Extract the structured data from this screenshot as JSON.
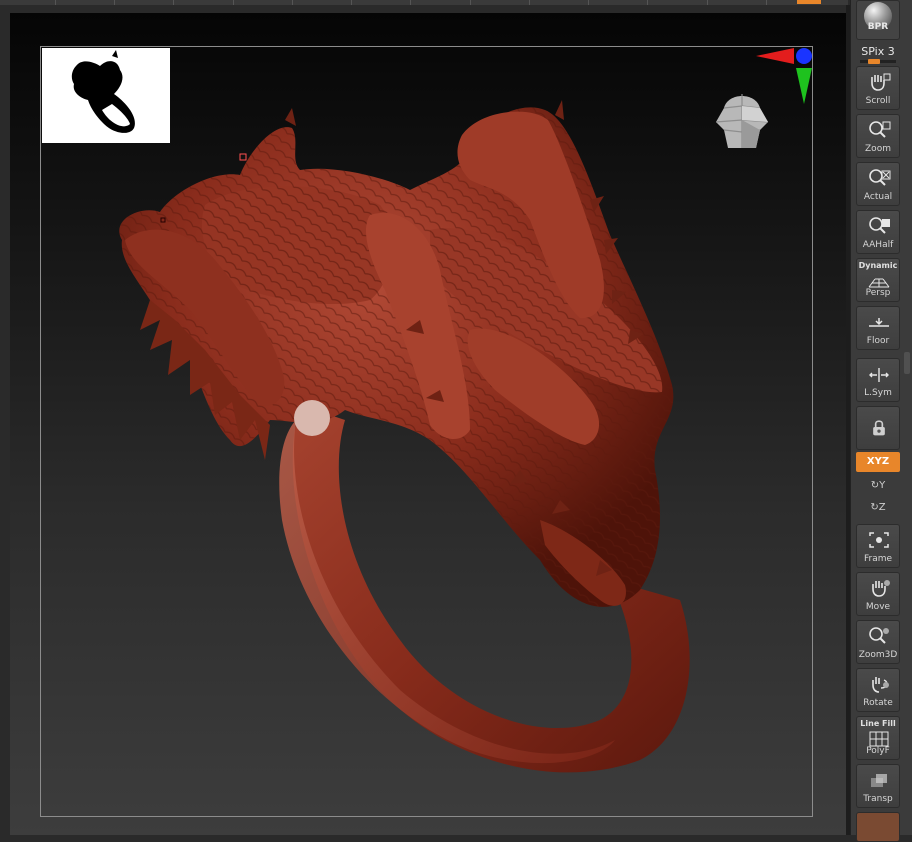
{
  "window": {
    "title": ""
  },
  "shelf": {
    "bpr": {
      "label": "BPR",
      "icon": "sphere-render-icon"
    },
    "spix": {
      "label": "SPix 3",
      "level": 3
    },
    "buttons": [
      {
        "id": "scroll",
        "label": "Scroll",
        "icon": "hand-scroll-icon"
      },
      {
        "id": "zoom",
        "label": "Zoom",
        "icon": "magnify-zoom-icon"
      },
      {
        "id": "actual",
        "label": "Actual",
        "icon": "magnify-actual-icon"
      },
      {
        "id": "aahalf",
        "label": "AAHalf",
        "icon": "magnify-aahalf-icon"
      },
      {
        "id": "persp",
        "label": "Persp",
        "sublabel": "Dynamic",
        "icon": "perspective-grid-icon"
      },
      {
        "id": "floor",
        "label": "Floor",
        "icon": "floor-grid-icon"
      },
      {
        "id": "lsym",
        "label": "L.Sym",
        "icon": "local-symmetry-icon"
      },
      {
        "id": "lock",
        "label": "",
        "icon": "lock-camera-icon"
      },
      {
        "id": "frame",
        "label": "Frame",
        "icon": "frame-icon"
      },
      {
        "id": "move",
        "label": "Move",
        "icon": "hand-move-icon"
      },
      {
        "id": "zoom3d",
        "label": "Zoom3D",
        "icon": "zoom3d-icon"
      },
      {
        "id": "rotate",
        "label": "Rotate",
        "icon": "rotate-icon"
      },
      {
        "id": "polyf",
        "label": "PolyF",
        "sublabel": "Line Fill",
        "icon": "polyframe-grid-icon"
      },
      {
        "id": "transp",
        "label": "Transp",
        "icon": "transparency-icon"
      }
    ],
    "xyz": {
      "label": "XYZ",
      "active": true
    },
    "rot_y": {
      "label": "Y"
    },
    "rot_z": {
      "label": "Z"
    }
  },
  "viewport": {
    "model": "dragon-ring",
    "model_color": "#8a2c1c",
    "thumbnail": "navigation-silhouette",
    "gizmo_axes": [
      "x-red",
      "y-green",
      "z-blue"
    ]
  },
  "colors": {
    "accent": "#e8862a",
    "shelf_bg": "#3b3b3b"
  }
}
